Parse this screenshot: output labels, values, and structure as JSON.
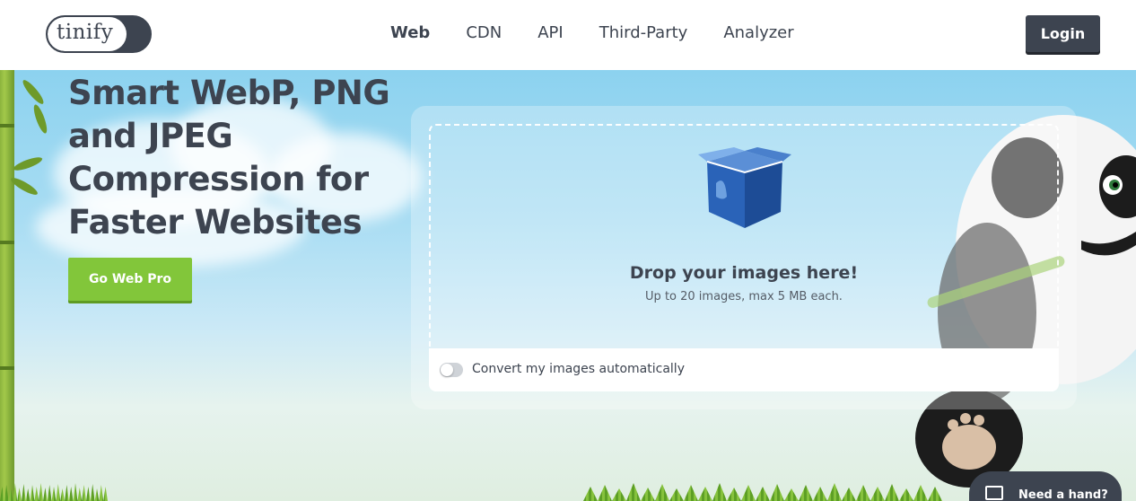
{
  "header": {
    "logo_text": "tinify",
    "nav": [
      {
        "label": "Web",
        "active": true
      },
      {
        "label": "CDN",
        "active": false
      },
      {
        "label": "API",
        "active": false
      },
      {
        "label": "Third-Party",
        "active": false
      },
      {
        "label": "Analyzer",
        "active": false
      }
    ],
    "login_label": "Login"
  },
  "hero": {
    "headline": "Smart WebP, PNG and JPEG Compression for Faster Websites",
    "cta_label": "Go Web Pro"
  },
  "dropzone": {
    "title": "Drop your images here!",
    "subtitle": "Up to 20 images, max 5 MB each.",
    "icon": "box-icon",
    "convert_label": "Convert my images automatically",
    "convert_enabled": false
  },
  "help": {
    "label": "Need a hand?",
    "icon": "chat-icon"
  },
  "colors": {
    "text_dark": "#3d4450",
    "accent_green": "#82c63a",
    "sky": "#8cd2ef",
    "box_blue": "#2a63b8"
  }
}
